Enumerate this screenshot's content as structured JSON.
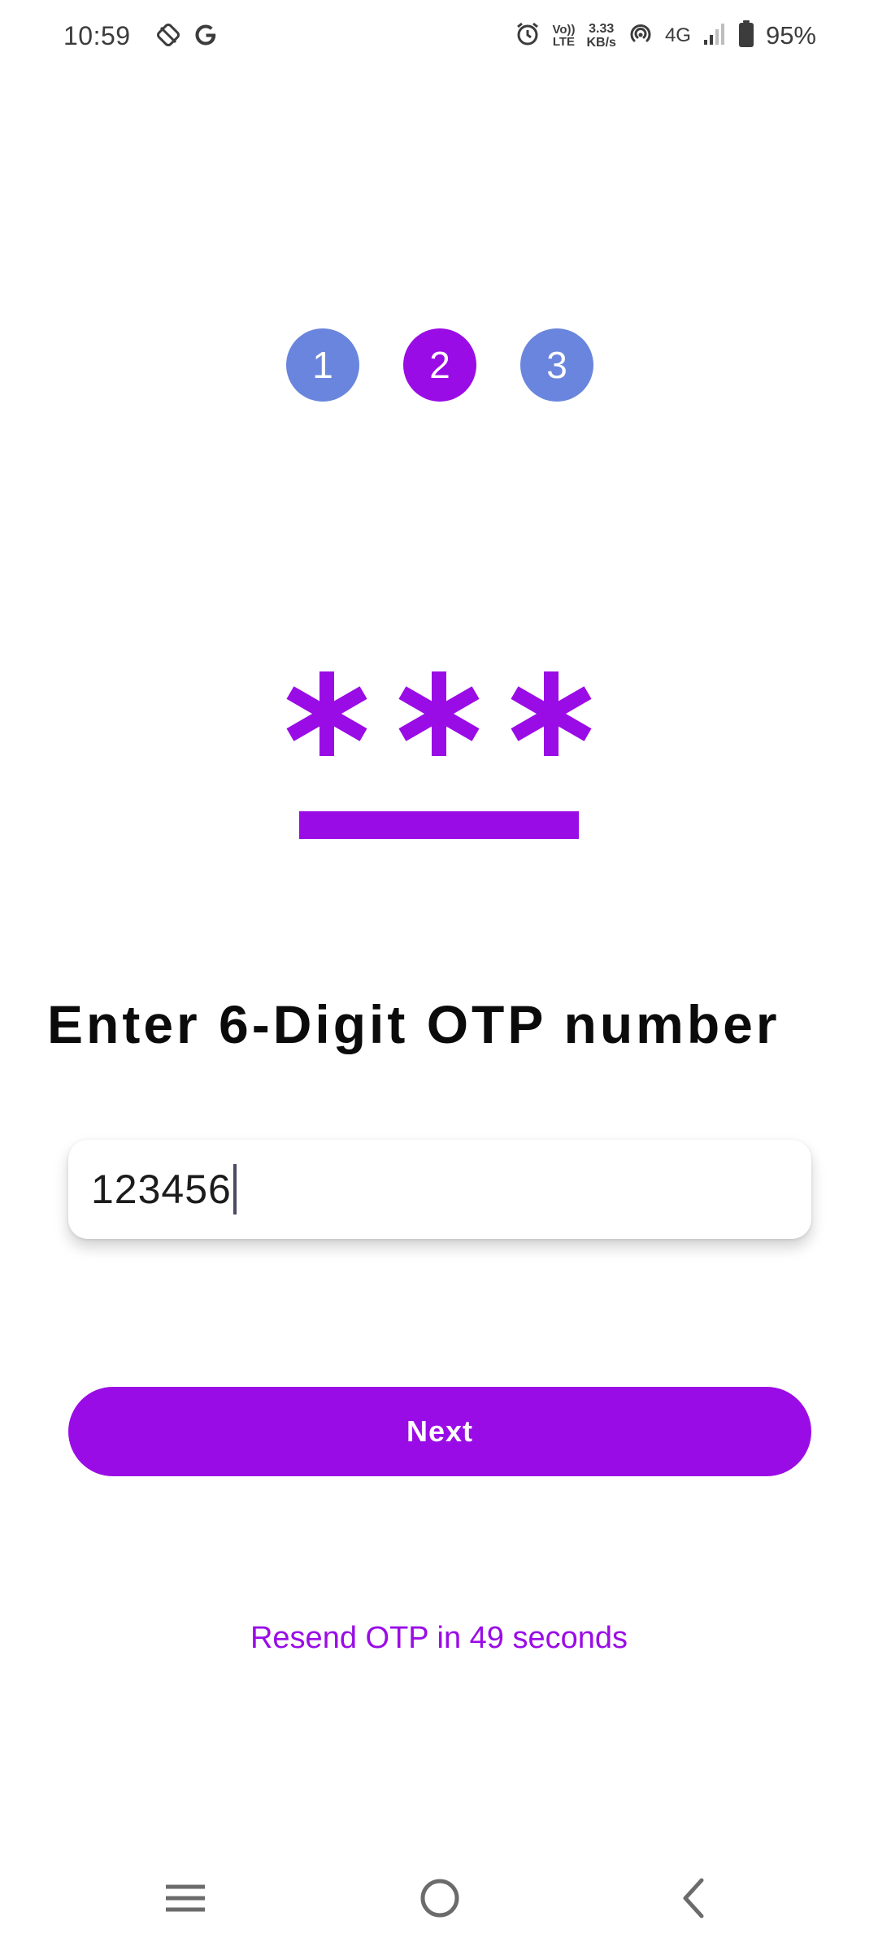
{
  "status_bar": {
    "time": "10:59",
    "left_icons": [
      "location-off-icon",
      "google-icon"
    ],
    "volte_top": "Vo))",
    "volte_bottom": "LTE",
    "speed_value": "3.33",
    "speed_unit": "KB/s",
    "network_type": "4G",
    "battery_percent": "95%",
    "right_icons": [
      "alarm-icon",
      "hotspot-icon",
      "signal-icon",
      "battery-icon"
    ]
  },
  "stepper": {
    "steps": [
      {
        "label": "1",
        "state": "inactive"
      },
      {
        "label": "2",
        "state": "active"
      },
      {
        "label": "3",
        "state": "inactive"
      }
    ]
  },
  "illustration": {
    "icon": "password-asterisks-icon"
  },
  "heading": "Enter 6-Digit OTP number",
  "otp_input": {
    "value": "123456"
  },
  "next_button": {
    "label": "Next"
  },
  "resend": {
    "prefix": "Resend OTP in ",
    "seconds": "49",
    "suffix": " seconds"
  },
  "nav_bar": {
    "items": [
      "menu-icon",
      "home-icon",
      "back-icon"
    ]
  },
  "colors": {
    "accent": "#9a0ce6",
    "step_inactive": "#6a85dd",
    "text_dark": "#0b0b0b",
    "status_text": "#3c3c3c",
    "nav_icon": "#6b6b6b"
  }
}
